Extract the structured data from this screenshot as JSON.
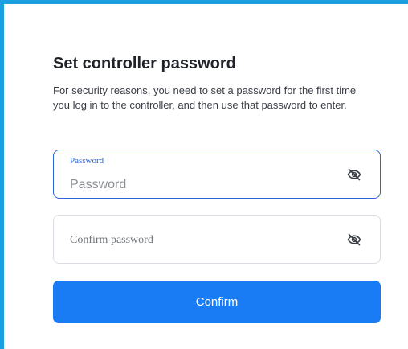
{
  "dialog": {
    "title": "Set controller password",
    "description": "For security reasons, you need to set a password for the first time you log in to the controller, and then use that password to enter."
  },
  "password_field": {
    "label": "Password",
    "placeholder": "Password",
    "value": "",
    "icon": "eye-off-icon"
  },
  "confirm_field": {
    "placeholder": "Confirm password",
    "value": "",
    "icon": "eye-off-icon"
  },
  "confirm_button": {
    "label": "Confirm"
  },
  "colors": {
    "accent": "#1a7cf4",
    "frame": "#1aa0e0",
    "focus_border": "#2a64d8"
  }
}
